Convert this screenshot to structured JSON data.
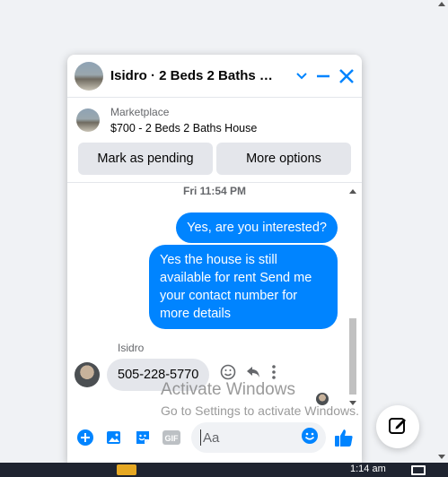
{
  "chat": {
    "title": "Isidro · 2 Beds 2 Baths Ho...",
    "marketplace_label": "Marketplace",
    "listing": "$700 - 2 Beds 2 Baths House",
    "mark_pending": "Mark as pending",
    "more_options": "More options",
    "timestamp": "Fri 11:54 PM",
    "messages_out": [
      "Yes, are you interested?",
      "Yes the house is still available for rent Send me your contact number for more details"
    ],
    "sender_name": "Isidro",
    "message_in": "505-228-5770",
    "input_placeholder": "Aa"
  },
  "watermark": {
    "title": "Activate Windows",
    "subtitle": "Go to Settings to activate Windows."
  },
  "taskbar": {
    "time": "1:14 am"
  },
  "colors": {
    "accent": "#0084ff"
  }
}
